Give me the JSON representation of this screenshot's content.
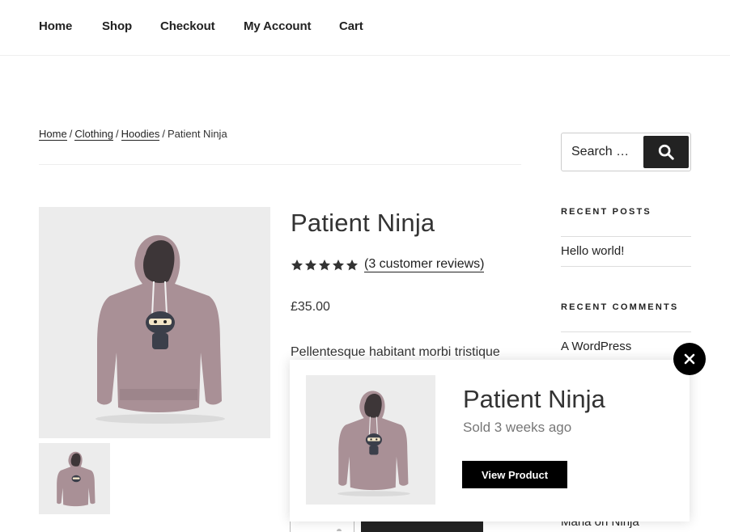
{
  "nav": {
    "items": [
      {
        "label": "Home"
      },
      {
        "label": "Shop"
      },
      {
        "label": "Checkout"
      },
      {
        "label": "My Account"
      },
      {
        "label": "Cart"
      }
    ]
  },
  "breadcrumb": {
    "items": [
      {
        "label": "Home"
      },
      {
        "label": "Clothing"
      },
      {
        "label": "Hoodies"
      }
    ],
    "separator": "/",
    "current": "Patient Ninja"
  },
  "product": {
    "title": "Patient Ninja",
    "rating": 5,
    "reviews_link": "(3 customer reviews)",
    "price": "£35.00",
    "description": "Pellentesque habitant morbi tristique",
    "hoodie_color": "#a99096",
    "image_bg": "#ececec"
  },
  "sidebar": {
    "search": {
      "placeholder": "Search …"
    },
    "recent_posts": {
      "title": "RECENT POSTS",
      "items": [
        {
          "label": "Hello world!"
        }
      ]
    },
    "recent_comments": {
      "title": "RECENT COMMENTS",
      "items": [
        {
          "label": "A WordPress"
        },
        {
          "label": "Maria on Ninja"
        }
      ]
    }
  },
  "popup": {
    "title": "Patient Ninja",
    "sold": "Sold 3 weeks ago",
    "button": "View Product",
    "close_icon": "close-icon"
  },
  "icons": {
    "search": "search-icon",
    "star": "star-icon"
  },
  "colors": {
    "text": "#222222",
    "accent_dark": "#222222",
    "popup_button": "#000000",
    "muted": "#777777"
  }
}
